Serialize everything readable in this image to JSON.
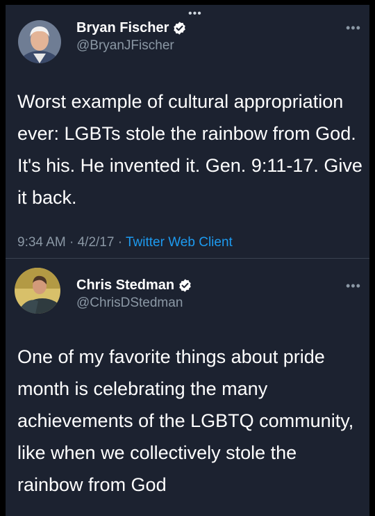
{
  "header": {
    "more_glyph": "•••"
  },
  "tweets": [
    {
      "author_name": "Bryan Fischer",
      "handle": "@BryanJFischer",
      "more_glyph": "•••",
      "text": "Worst example of cultural appropriation ever: LGBTs stole the rainbow from God. It's his. He invented it. Gen. 9:11-17. Give it back.",
      "time": "9:34 AM",
      "separator": "·",
      "date": "4/2/17",
      "client": "Twitter Web Client"
    },
    {
      "author_name": "Chris Stedman",
      "handle": "@ChrisDStedman",
      "more_glyph": "•••",
      "text": "One of my favorite things about pride month is celebrating the many achievements of the LGBTQ community, like when we collectively stole the rainbow from God"
    }
  ],
  "colors": {
    "background": "#1c2230",
    "text": "#ffffff",
    "secondary": "#8b98a5",
    "link": "#1d9bf0",
    "verified": "#ffffff"
  }
}
